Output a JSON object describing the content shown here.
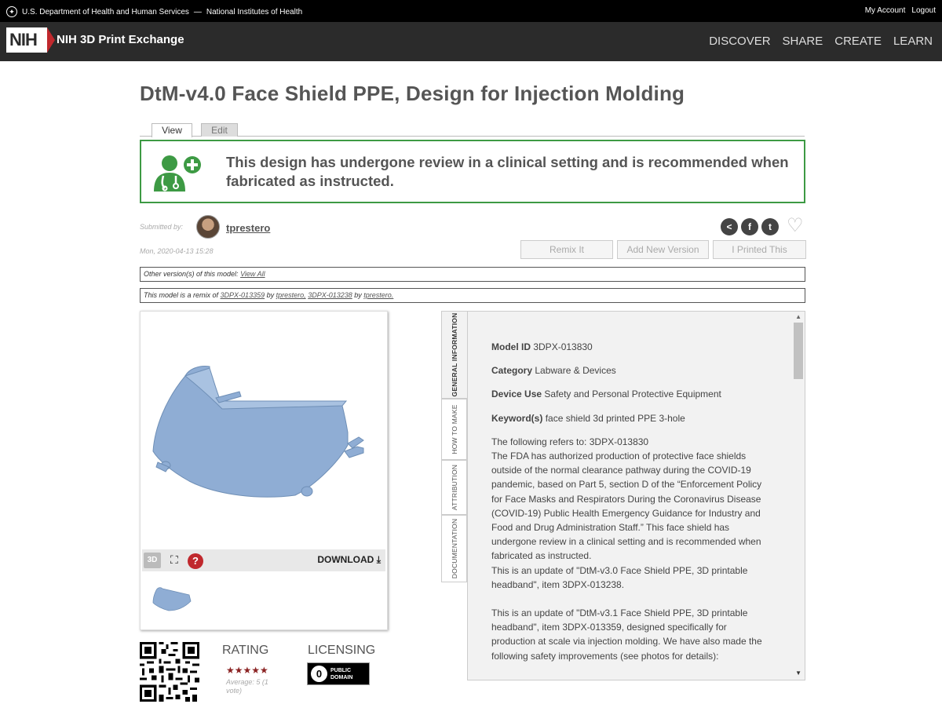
{
  "hhs": {
    "left_text": "U.S. Department of Health and Human Services",
    "separator": "—",
    "nih_text": "National Institutes of Health",
    "my_account": "My Account",
    "logout": "Logout"
  },
  "nav": {
    "logo": "NIH",
    "site_name": "NIH 3D Print Exchange",
    "links": [
      "DISCOVER",
      "SHARE",
      "CREATE",
      "LEARN"
    ]
  },
  "page_title": "DtM-v4.0 Face Shield PPE, Design for Injection Molding",
  "tabs": {
    "view": "View",
    "edit": "Edit"
  },
  "banner": {
    "text": "This design has undergone review in a clinical setting and is recommended when fabricated as instructed.",
    "accent": "#3d9a44"
  },
  "submission": {
    "label": "Submitted by:",
    "author": "tprestero",
    "date": "Mon, 2020-04-13 15:28"
  },
  "actions": {
    "remix": "Remix It",
    "add_version": "Add New Version",
    "printed": "I Printed This"
  },
  "versions": {
    "prefix": "Other version(s) of this model:",
    "link": "View All"
  },
  "remix": {
    "prefix": "This model is a remix of",
    "item1": "3DPX-013359",
    "by": "by",
    "author1": "tprestero,",
    "item2": "3DPX-013238",
    "author2": "tprestero."
  },
  "viewer": {
    "icon_3d": "3D",
    "help": "?",
    "download": "DOWNLOAD",
    "model_color": "#8fadd4"
  },
  "rating": {
    "title": "RATING",
    "stars": "★★★★★",
    "average": "Average: 5 (1 vote)"
  },
  "licensing": {
    "title": "LICENSING",
    "badge_line1": "PUBLIC",
    "badge_line2": "DOMAIN"
  },
  "side_tabs": [
    "GENERAL INFORMATION",
    "HOW TO MAKE",
    "ATTRIBUTION",
    "DOCUMENTATION"
  ],
  "details": {
    "model_id_label": "Model ID",
    "model_id": "3DPX-013830",
    "category_label": "Category",
    "category": "Labware & Devices",
    "device_use_label": "Device Use",
    "device_use": "Safety and Personal Protective Equipment",
    "keywords_label": "Keyword(s)",
    "keywords": "face shield 3d printed PPE 3-hole",
    "desc1": "The following refers to: 3DPX-013830",
    "desc2": "The FDA has authorized production of protective face shields outside of the normal clearance pathway during the COVID-19 pandemic, based on Part 5, section D of the “Enforcement Policy for Face Masks and Respirators During the Coronavirus Disease (COVID-19) Public Health Emergency Guidance for Industry and Food and Drug Administration Staff.” This face shield has undergone review in a clinical setting and is recommended when fabricated as instructed.",
    "desc3": "This is an update of \"DtM-v3.0 Face Shield PPE, 3D printable headband\", item 3DPX-013238.",
    "desc4": "This is an update of \"DtM-v3.1 Face Shield PPE, 3D printable headband\", item 3DPX-013359, designed specifically for production at scale via injection molding.  We have also made the following safety improvements (see photos for details):"
  }
}
